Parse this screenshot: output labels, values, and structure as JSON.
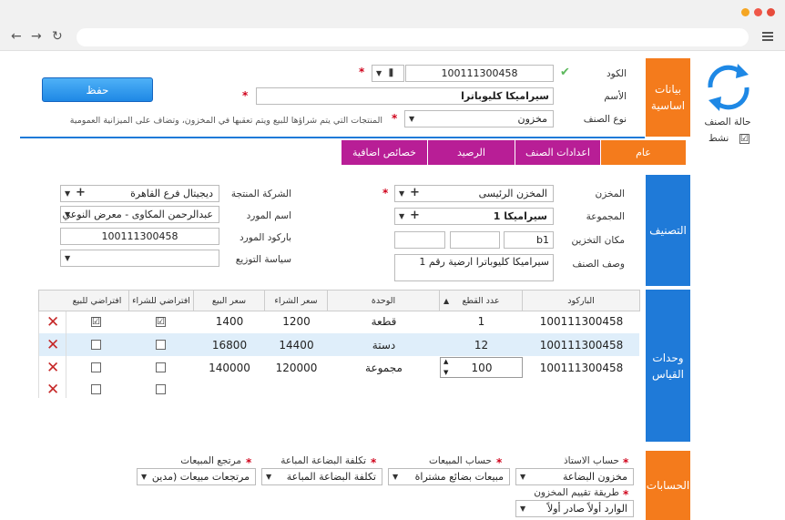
{
  "browser": {
    "nav_back": "←",
    "nav_forward": "→",
    "reload": "↻"
  },
  "save_button": "حفظ",
  "status": {
    "label": "حالة الصنف",
    "active_label": "نشط",
    "active_checked": "☑"
  },
  "basic": {
    "section_title": "بيانات اساسية",
    "code_label": "الكود",
    "code_value": "100111300458",
    "name_label": "الأسم",
    "name_value": "سيراميكا كليوباترا",
    "type_label": "نوع الصنف",
    "type_value": "مخزون",
    "type_hint": "المنتجات التي يتم شراؤها للبيع ويتم تعقبها  في المخزون، وتضاف على الميزانية العمومية"
  },
  "tabs": [
    {
      "label": "عام",
      "color": "#f47b1c"
    },
    {
      "label": "اعدادات الصنف",
      "color": "#b81e96"
    },
    {
      "label": "الرصيد",
      "color": "#b81e96"
    },
    {
      "label": "خصائص اضافية",
      "color": "#b81e96"
    }
  ],
  "classification": {
    "section_title": "التصنيف",
    "warehouse_label": "المخزن",
    "warehouse_value": "المخزن الرئيسى",
    "group_label": "المجموعة",
    "group_value": "سيراميكا 1",
    "location_label": "مكان التخزين",
    "location_value": "b1",
    "desc_label": "وصف الصنف",
    "desc_value": "سيراميكا كليوباترا ارضية رقم 1",
    "company_label": "الشركة المنتجة",
    "company_value": "ديجيتال فرع القاهرة",
    "supplier_label": "اسم المورد",
    "supplier_value": "عبدالرحمن المكاوى - معرض النوعي",
    "supplier_barcode_label": "باركود المورد",
    "supplier_barcode_value": "100111300458",
    "distribution_label": "سياسة التوزيع",
    "distribution_value": ""
  },
  "units": {
    "section_title": "وحدات القياس",
    "headers": {
      "barcode": "الباركود",
      "count": "عدد القطع",
      "unit": "الوحدة",
      "buy_price": "سعر الشراء",
      "sell_price": "سعر البيع",
      "default_buy": "افتراضي للشراء",
      "default_sell": "افتراضي للبيع"
    },
    "rows": [
      {
        "barcode": "100111300458",
        "count": "1",
        "unit": "قطعة",
        "buy": "1200",
        "sell": "1400",
        "def_buy": "☑",
        "def_sell": "☑"
      },
      {
        "barcode": "100111300458",
        "count": "12",
        "unit": "دستة",
        "buy": "14400",
        "sell": "16800",
        "def_buy": "",
        "def_sell": ""
      },
      {
        "barcode": "100111300458",
        "count": "100",
        "unit": "مجموعة",
        "buy": "120000",
        "sell": "140000",
        "def_buy": "",
        "def_sell": ""
      },
      {
        "barcode": "",
        "count": "",
        "unit": "",
        "buy": "",
        "sell": "",
        "def_buy": "",
        "def_sell": ""
      }
    ]
  },
  "accounts": {
    "section_title": "الحسابات",
    "inventory_label": "حساب الاستاذ",
    "inventory_value": "مخزون البضاعة",
    "sales_label": "حساب المبيعات",
    "sales_value": "مبيعات بضائع مشتراة",
    "cogs_label": "تكلفة البضاعة المباعة",
    "cogs_value": "تكلفة البضاعة المباعة",
    "returns_label": "مرتجع المبيعات",
    "returns_value": "مرتجعات مبيعات  (مدين",
    "valuation_label": "طريقة تقييم المخزون",
    "valuation_value": "الوارد أولاً صادر أولاً"
  }
}
